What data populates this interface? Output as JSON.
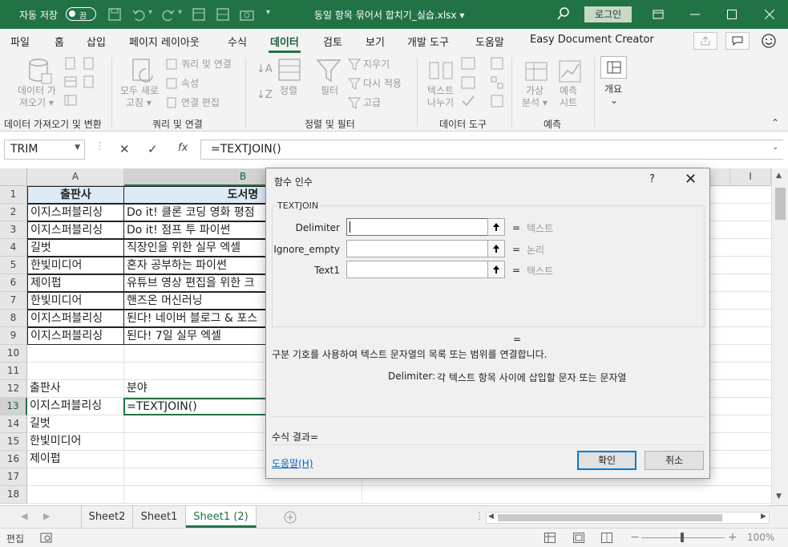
{
  "titlebar": {
    "autosave_label": "자동 저장",
    "autosave_state": "끔",
    "doc_title": "동일 항목 묶어서 합치기_실습.xlsx ▾",
    "login": "로그인"
  },
  "tabs": [
    "파일",
    "홈",
    "삽입",
    "페이지 레이아웃",
    "수식",
    "데이터",
    "검토",
    "보기",
    "개발 도구",
    "도움말",
    "Easy Document Creator"
  ],
  "active_tab": "데이터",
  "ribbon": {
    "get_data": [
      "데이터 가",
      "져오기 ▾"
    ],
    "refresh_all": [
      "모두 새로",
      "고침 ▾"
    ],
    "queries_connections": "쿼리 및 연결",
    "properties": "속성",
    "edit_links": "연결 편집",
    "sort": "정렬",
    "filter": "필터",
    "clear": "지우기",
    "reapply": "다시 적용",
    "advanced": "고급",
    "text_to_columns": [
      "텍스트",
      "나누기"
    ],
    "what_if": [
      "가상",
      "분석 ▾"
    ],
    "forecast_sheet": [
      "예측",
      "시트"
    ],
    "outline": [
      "개요",
      "⌄"
    ],
    "groups": [
      "데이터 가져오기 및 변환",
      "쿼리 및 연결",
      "정렬 및 필터",
      "데이터 도구",
      "예측"
    ]
  },
  "formula_bar": {
    "name_box": "TRIM",
    "formula": "=TEXTJOIN()"
  },
  "columns": [
    "A",
    "B",
    "I"
  ],
  "rows": [
    "1",
    "2",
    "3",
    "4",
    "5",
    "6",
    "7",
    "8",
    "9",
    "10",
    "11",
    "12",
    "13",
    "14",
    "15",
    "16",
    "17",
    "18"
  ],
  "table": {
    "header": [
      "출판사",
      "도서명"
    ],
    "data": [
      [
        "이지스퍼블리싱",
        "Do it! 클론 코딩 영화 평점"
      ],
      [
        "이지스퍼블리싱",
        "Do it! 점프 투 파이썬"
      ],
      [
        "길벗",
        "직장인을 위한 실무 엑셀"
      ],
      [
        "한빛미디어",
        "혼자 공부하는 파이썬"
      ],
      [
        "제이펍",
        "유튜브 영상 편집을 위한 크"
      ],
      [
        "한빛미디어",
        "핸즈온 머신러닝"
      ],
      [
        "이지스퍼블리싱",
        "된다! 네이버 블로그 & 포스"
      ],
      [
        "이지스퍼블리싱",
        "된다! 7일 실무 엑셀"
      ]
    ]
  },
  "lower": {
    "header": [
      "출판사",
      "분야"
    ],
    "data": [
      [
        "이지스퍼블리싱",
        "=TEXTJOIN()"
      ],
      [
        "길벗",
        ""
      ],
      [
        "한빛미디어",
        ""
      ],
      [
        "제이펍",
        ""
      ]
    ]
  },
  "sheets": [
    "Sheet2",
    "Sheet1",
    "Sheet1 (2)"
  ],
  "active_sheet": "Sheet1 (2)",
  "status": {
    "mode": "편집",
    "zoom": "100%"
  },
  "dialog": {
    "title": "함수 인수",
    "help": "?",
    "function_name": "TEXTJOIN",
    "args": [
      {
        "label": "Delimiter",
        "type": "텍스트"
      },
      {
        "label": "Ignore_empty",
        "type": "논리"
      },
      {
        "label": "Text1",
        "type": "텍스트"
      }
    ],
    "equals": "=",
    "result_equals": "=",
    "description": "구분 기호를 사용하여 텍스트 문자열의 목록 또는 범위를 연결합니다.",
    "arg_help_name": "Delimiter:",
    "arg_help_text": "각 텍스트 항목 사이에 삽입할 문자 또는 문자열",
    "formula_result": "수식 결과=",
    "help_link": "도움말(H)",
    "ok": "확인",
    "cancel": "취소"
  }
}
